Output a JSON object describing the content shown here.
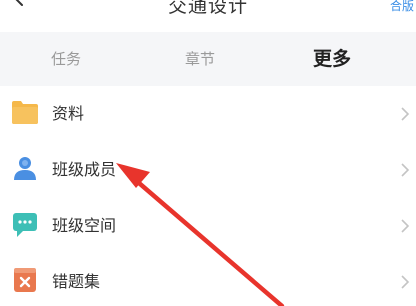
{
  "header": {
    "title": "交通设计",
    "action_label": "合版"
  },
  "tabs": [
    {
      "label": "任务",
      "active": false
    },
    {
      "label": "章节",
      "active": false
    },
    {
      "label": "更多",
      "active": true
    }
  ],
  "menu": {
    "items": [
      {
        "label": "资料",
        "icon": "folder-icon"
      },
      {
        "label": "班级成员",
        "icon": "person-icon"
      },
      {
        "label": "班级空间",
        "icon": "chat-bubble-icon"
      },
      {
        "label": "错题集",
        "icon": "wrong-questions-icon"
      }
    ]
  },
  "colors": {
    "accent_arrow": "#e8342c",
    "tab_bar_bg": "#f5f6f8",
    "folder": "#f5b84a",
    "person": "#4a8fe2",
    "chat": "#3dbfb6",
    "wrong": "#e9784e"
  }
}
